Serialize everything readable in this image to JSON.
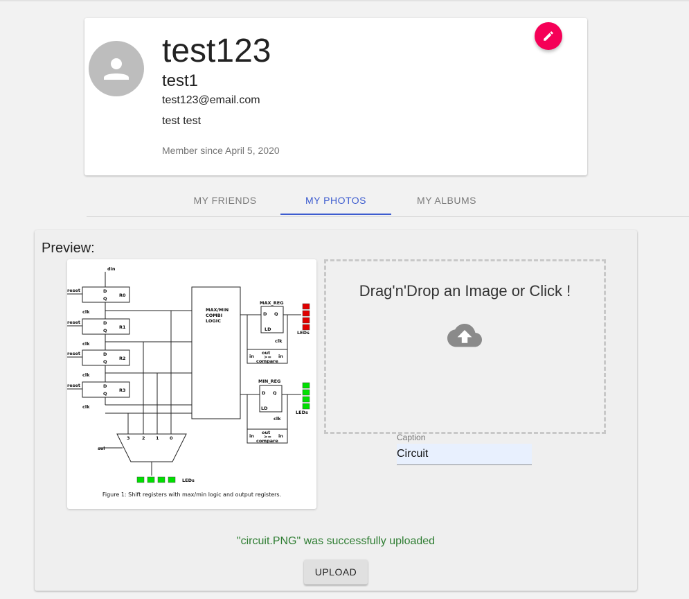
{
  "profile": {
    "username": "test123",
    "full_name": "test1",
    "email": "test123@email.com",
    "bio": "test test",
    "member_since": "Member since April 5, 2020",
    "edit_icon": "pencil-icon",
    "avatar_icon": "person-icon",
    "accent_color": "#f50057"
  },
  "tabs": [
    {
      "label": "MY FRIENDS",
      "active": false
    },
    {
      "label": "MY PHOTOS",
      "active": true
    },
    {
      "label": "MY ALBUMS",
      "active": false
    }
  ],
  "upload": {
    "preview_label": "Preview:",
    "dropzone_text": "Drag'n'Drop an Image or Click !",
    "dropzone_icon": "cloud-upload-icon",
    "caption_label": "Caption",
    "caption_value": "Circuit",
    "status_message": "\"circuit.PNG\" was successfully uploaded",
    "upload_button": "UPLOAD"
  },
  "preview_image": {
    "figure_caption": "Figure 1: Shift registers with max/min logic and output registers.",
    "labels": {
      "din": "din",
      "reset": "reset",
      "clk": "clk",
      "registers": [
        "R0",
        "R1",
        "R2",
        "R3"
      ],
      "reg_d": "D",
      "reg_q": "Q",
      "logic_block": [
        "MAX/MIN",
        "COMBI",
        "LOGIC"
      ],
      "max_reg": "MAX_REG",
      "min_reg": "MIN_REG",
      "ld": "LD",
      "leds": "LEDs",
      "out": "out",
      "in": "in",
      "ge": ">=",
      "compare": "compare",
      "sel": "sel",
      "mux_inputs": [
        "3",
        "2",
        "1",
        "0"
      ]
    }
  }
}
